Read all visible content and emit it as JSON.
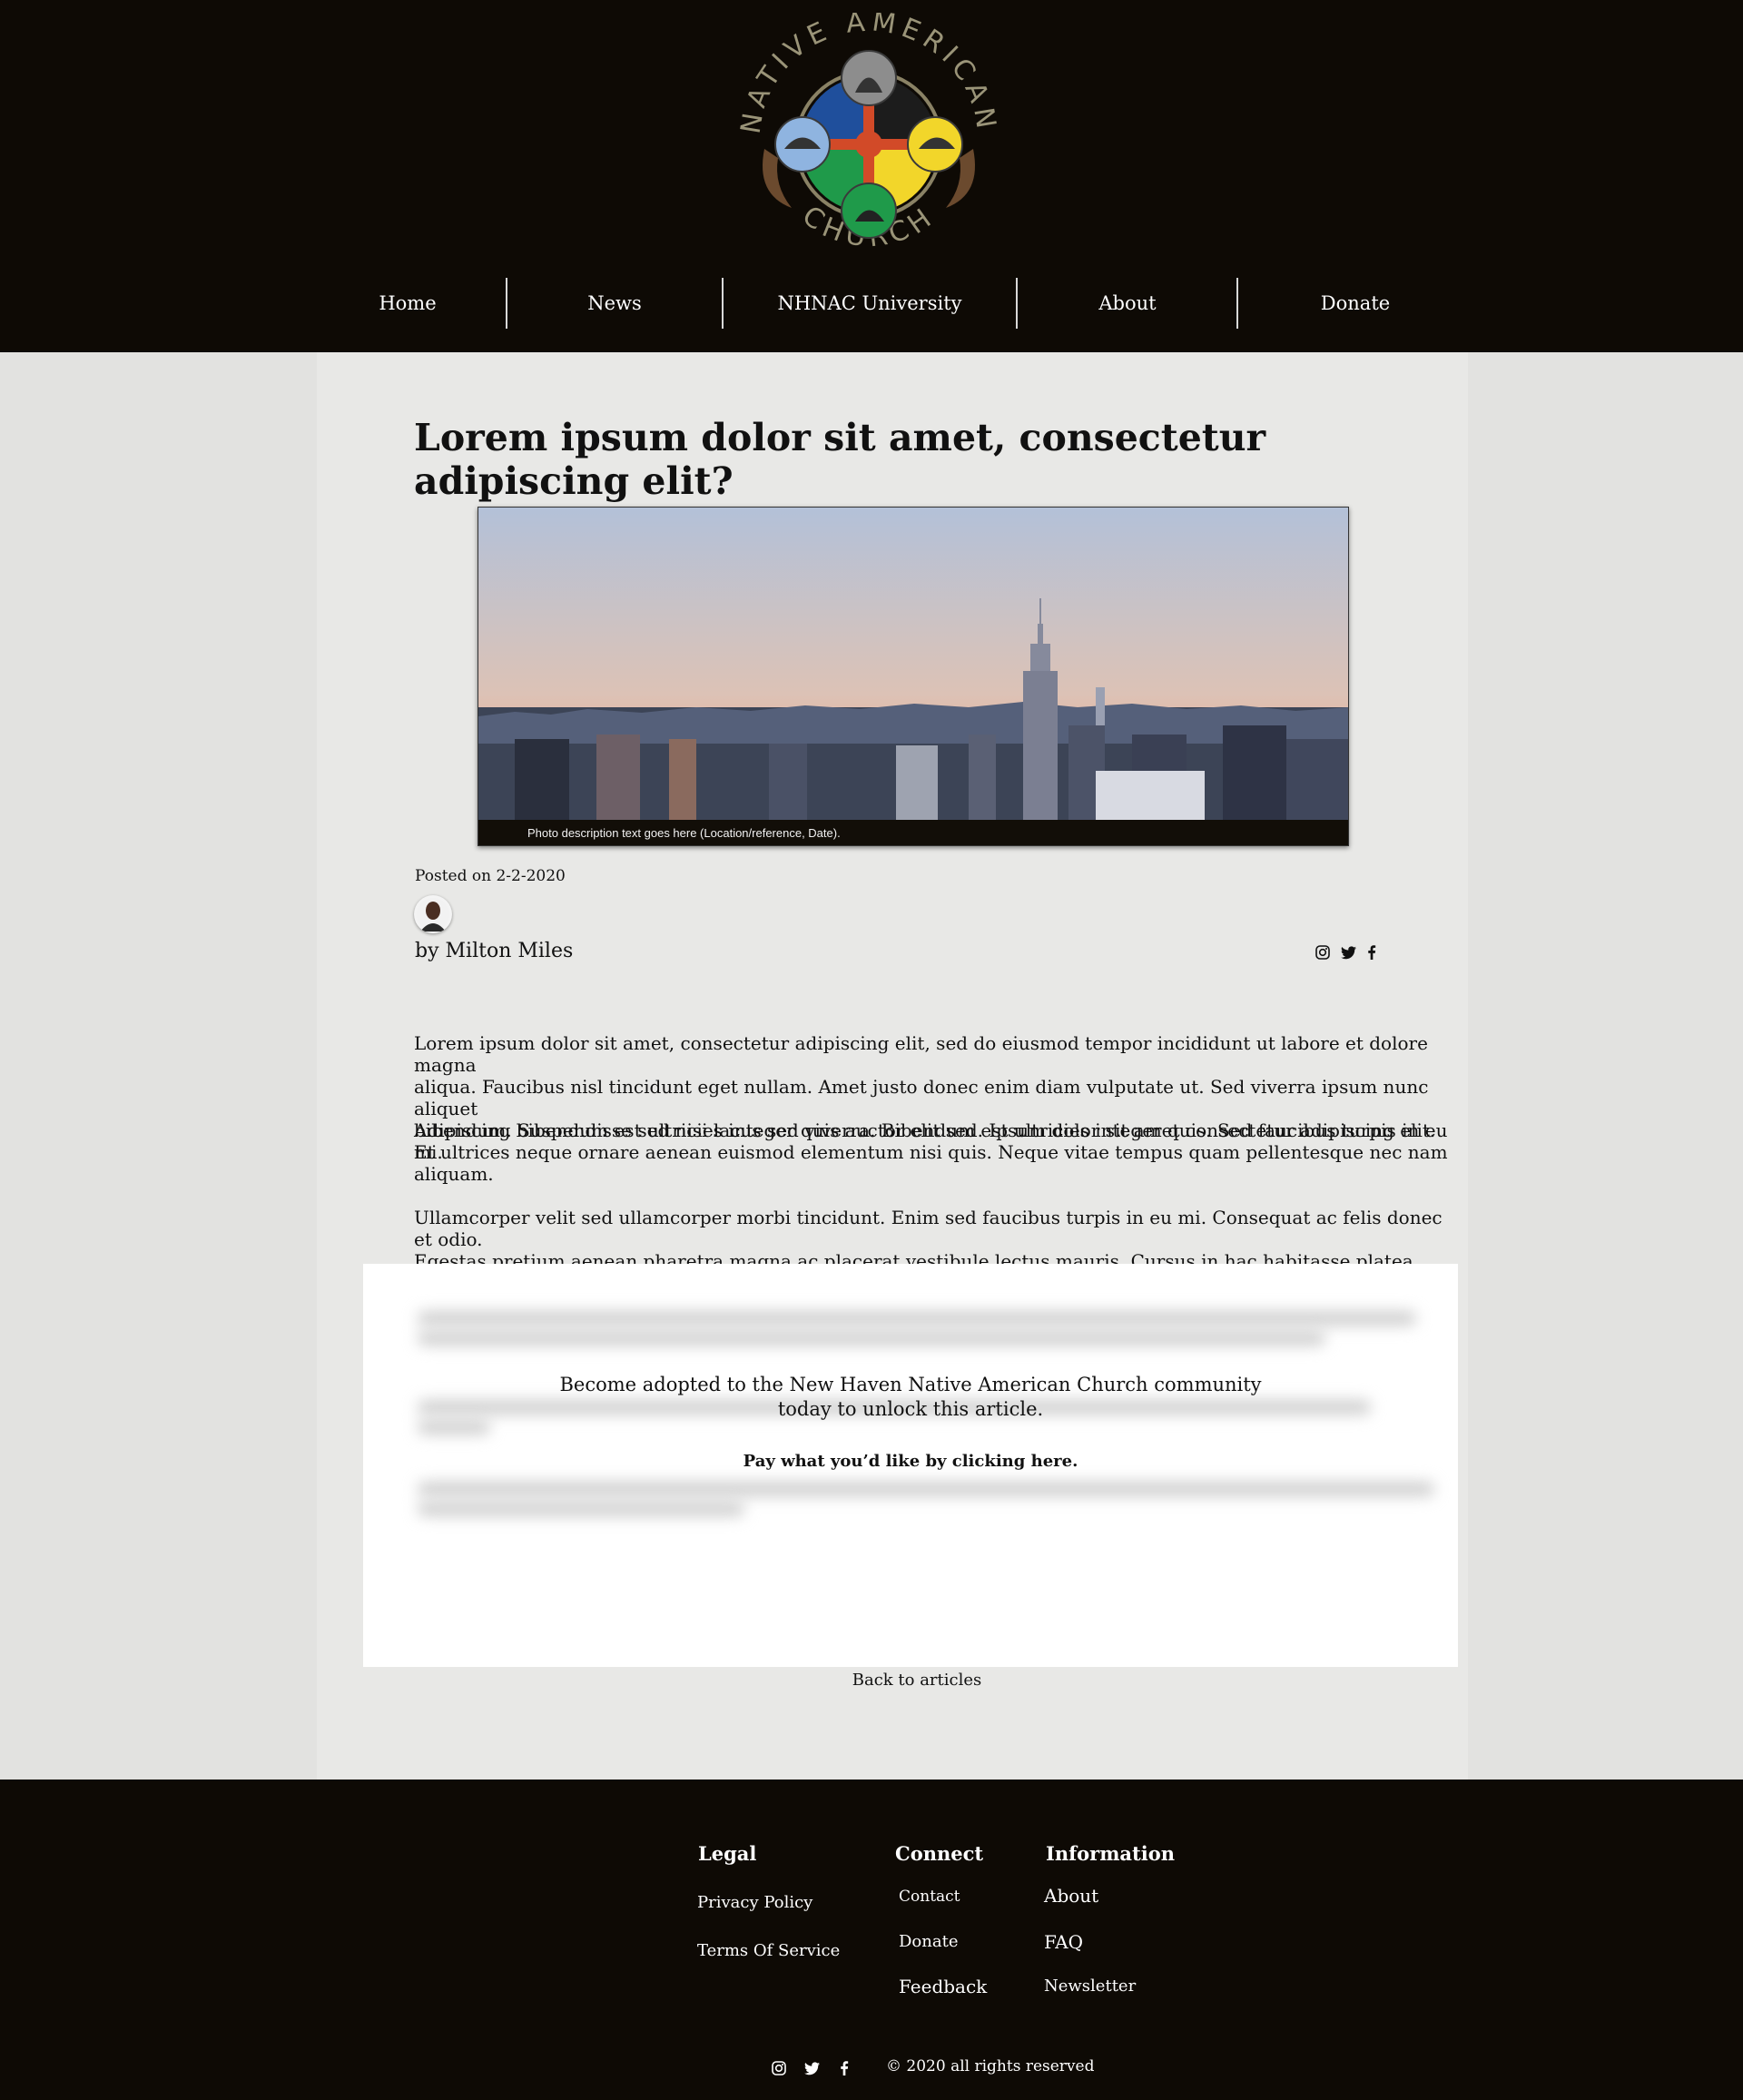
{
  "header": {
    "logo_text_top": "NATIVE AMERICAN",
    "logo_text_bottom": "CHURCH"
  },
  "nav": {
    "items": [
      {
        "label": "Home"
      },
      {
        "label": "News"
      },
      {
        "label": "NHNAC University"
      },
      {
        "label": "About"
      },
      {
        "label": "Donate"
      }
    ]
  },
  "article": {
    "title": "Lorem ipsum dolor sit amet, consectetur adipiscing elit?",
    "photo_caption": "Photo description text goes here (Location/reference, Date).",
    "posted": "Posted on 2-2-2020",
    "byline": "by Milton Miles",
    "share_icons": [
      "instagram-icon",
      "twitter-icon",
      "facebook-icon"
    ],
    "paragraphs": [
      "Lorem ipsum dolor sit amet, consectetur adipiscing elit, sed do eiusmod tempor incididunt ut labore et dolore magna\n aliqua. Faucibus nisl tincidunt eget nullam. Amet justo donec enim diam vulputate ut. Sed viverra ipsum nunc aliquet\nbibendum. Suspendisse sed nisi lacus sed viverra. Bibendum est ultricies integer quis. Sed faucibus turpis in eu mi.",
      "Adipiscing bibendum est ultricies integer quis auctor elit sed. Ipsum dolor sit amet consectetur adipiscing elit.\nEt ultrices neque ornare aenean euismod elementum nisi quis. Neque vitae tempus quam pellentesque nec nam\naliquam.",
      "Ullamcorper velit sed ullamcorper morbi tincidunt. Enim sed faucibus turpis in eu mi. Consequat ac felis donec et odio.\nEgestas pretium aenean pharetra magna ac placerat vestibule lectus mauris. Cursus in hac habitasse platea dictumst.\nPorttitor eget dolor morbi non arcu risus."
    ],
    "paywall_message": "Become adopted to the New Haven Native American Church community\ntoday to unlock this article.",
    "paywall_cta": "Pay what you’d like by clicking here.",
    "back_link": "Back to articles"
  },
  "footer": {
    "legal": {
      "heading": "Legal",
      "links": [
        "Privacy Policy",
        "Terms Of Service"
      ]
    },
    "connect": {
      "heading": "Connect",
      "links": [
        "Contact",
        "Donate",
        "Feedback"
      ]
    },
    "information": {
      "heading": "Information",
      "links": [
        "About",
        "FAQ",
        "Newsletter"
      ]
    },
    "social_icons": [
      "instagram-icon",
      "twitter-icon",
      "facebook-icon"
    ],
    "copyright": "© 2020 all rights reserved"
  },
  "colors": {
    "header_bg": "#0e0a05",
    "column_bg": "#e8e8e6",
    "page_bg": "#e2e2e0",
    "logo_blue": "#1f4f9c",
    "logo_yellow": "#f2d62a",
    "logo_green": "#1f9a4a",
    "logo_red": "#d24a28"
  }
}
